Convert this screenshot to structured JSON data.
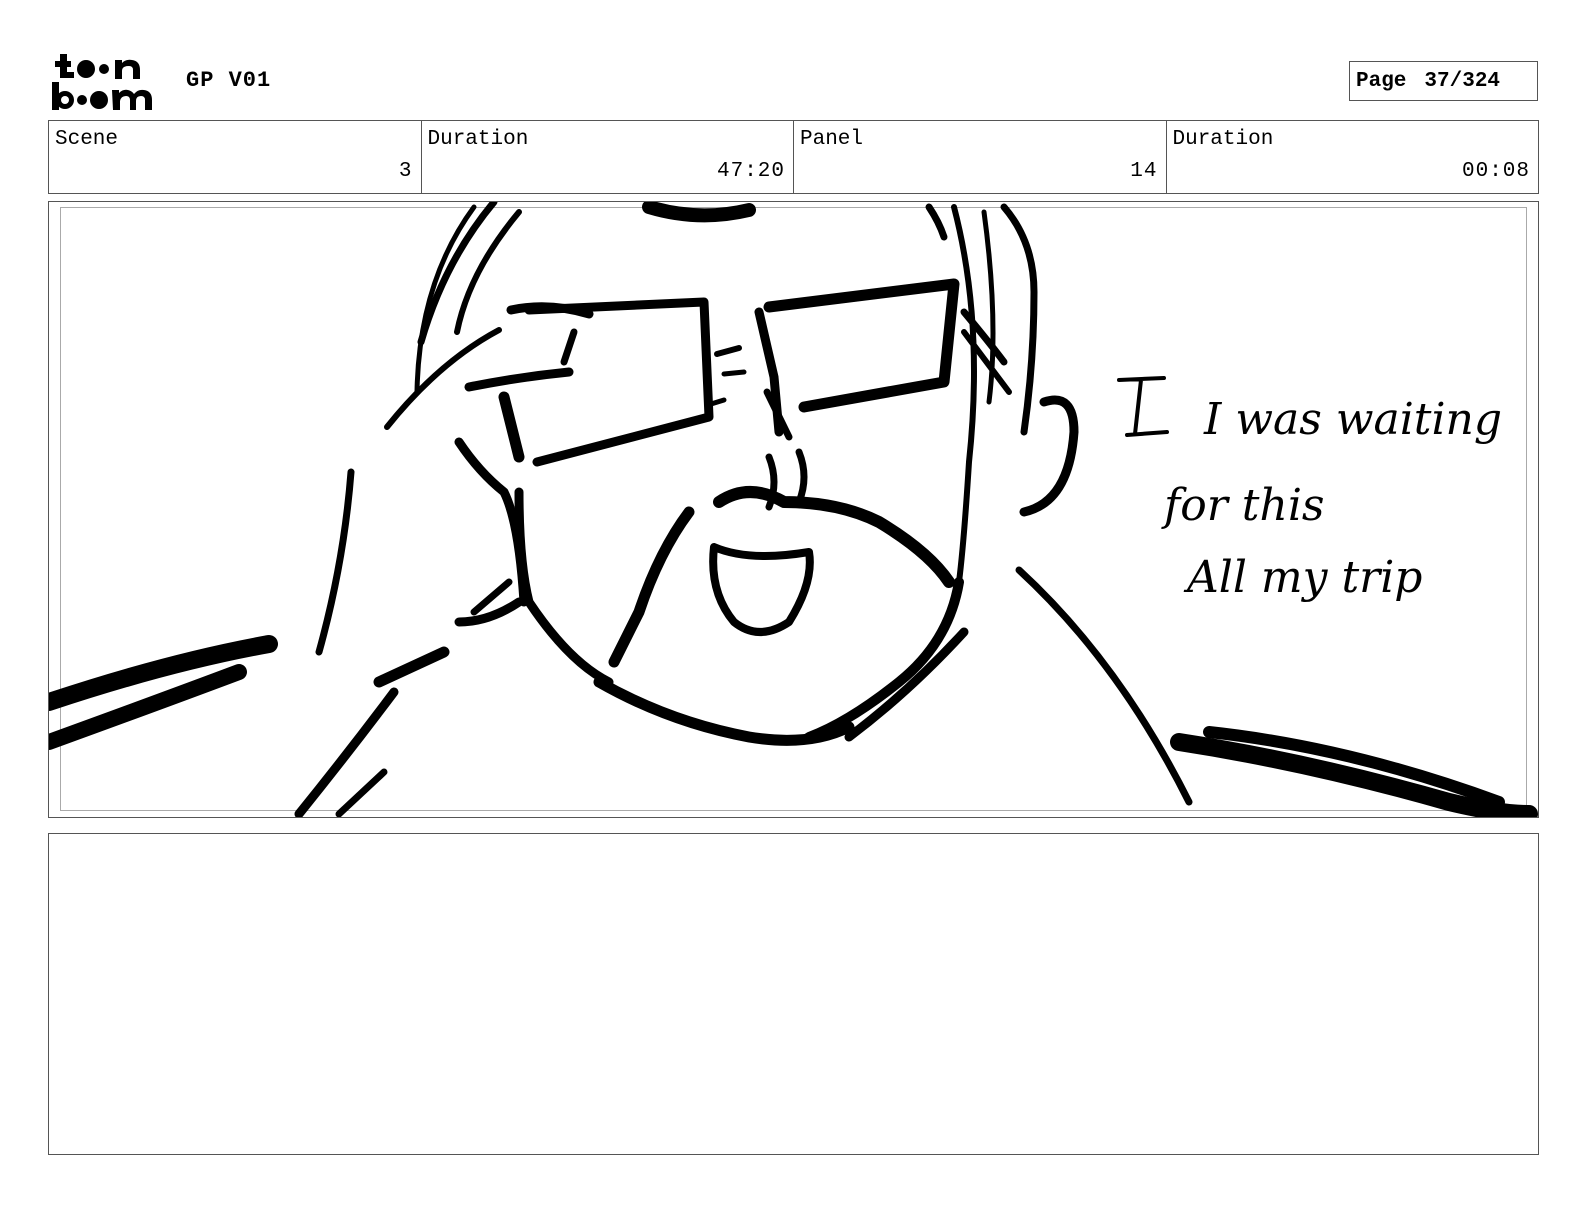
{
  "header": {
    "logo_text": "toon boom",
    "project_title": "GP V01",
    "page_label": "Page",
    "page_number": "37/324"
  },
  "info": {
    "scene_label": "Scene",
    "scene_value": "3",
    "scene_duration_label": "Duration",
    "scene_duration_value": "47:20",
    "panel_label": "Panel",
    "panel_value": "14",
    "panel_duration_label": "Duration",
    "panel_duration_value": "00:08"
  },
  "panel": {
    "dialogue_lines": [
      "I was waiting",
      "for this",
      "All my trip"
    ]
  },
  "notes": {
    "text": ""
  }
}
